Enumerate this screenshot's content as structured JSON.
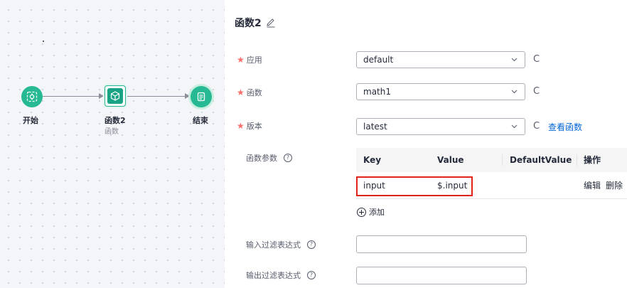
{
  "canvas": {
    "nodes": [
      {
        "label": "开始",
        "sub": ""
      },
      {
        "label": "函数2",
        "sub": "函数"
      },
      {
        "label": "结束",
        "sub": ""
      }
    ]
  },
  "panel": {
    "title": "函数2",
    "fields": {
      "app": {
        "label": "应用",
        "value": "default",
        "required": true
      },
      "function": {
        "label": "函数",
        "value": "math1",
        "required": true
      },
      "version": {
        "label": "版本",
        "value": "latest",
        "required": true,
        "link": "查看函数"
      }
    },
    "params": {
      "label": "函数参数",
      "columns": [
        "Key",
        "Value",
        "DefaultValue",
        "操作"
      ],
      "rows": [
        {
          "key": "input",
          "value": "$.input",
          "default": "",
          "actions": [
            "编辑",
            "删除"
          ]
        }
      ],
      "add_label": "添加"
    },
    "input_filter": {
      "label": "输入过滤表达式",
      "value": ""
    },
    "output_filter": {
      "label": "输出过滤表达式",
      "value": ""
    },
    "help_symbol": "?",
    "refresh_symbol": "C"
  },
  "colors": {
    "accent": "#27b993",
    "link": "#0066d9",
    "required": "#f66f6a",
    "highlight": "#e2231a"
  }
}
